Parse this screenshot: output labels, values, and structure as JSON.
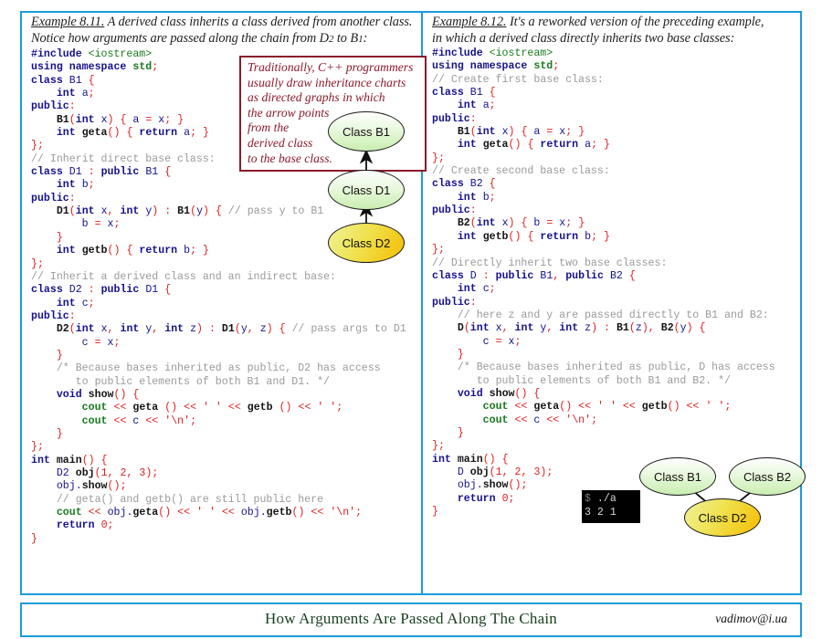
{
  "theme": {
    "frame_color": "#1a9cd8",
    "callout_color": "#8b1a2b",
    "base_node_color": "#c9eeb0",
    "derived_node_color": "#f0e04a",
    "comment_color": "#9a9a9a",
    "keyword_color": "#16128c",
    "punct_color": "#e02020",
    "string_color": "#1a7a1f",
    "footer_title_color": "#19411f"
  },
  "left": {
    "example_label": "Example 8.11.",
    "intro_line1": "A derived class inherits a class derived from another class.",
    "intro_line2_a": "Notice how arguments are passed along the chain from D",
    "intro_line2_sub1": "2",
    "intro_line2_b": " to B",
    "intro_line2_sub2": "1",
    "intro_line2_c": ":",
    "code": "#include <iostream>\nusing namespace std;\nclass B1 {\n    int a;\npublic:\n    B1(int x) { a = x; }\n    int geta() { return a; }\n};\n// Inherit direct base class:\nclass D1 : public B1 {\n    int b;\npublic:\n    D1(int x, int y) : B1(y) { // pass y to B1\n        b = x;\n    }\n    int getb() { return b; }\n};\n// Inherit a derived class and an indirect base:\nclass D2 : public D1 {\n    int c;\npublic:\n    D2(int x, int y, int z) : D1(y, z) { // pass args to D1\n        c = x;\n    }\n    /* Because bases inherited as public, D2 has access\n       to public elements of both B1 and D1. */\n    void show() {\n        cout << geta () << ' ' << getb () << ' ';\n        cout << c << '\\n';\n    }\n};\nint main() {\n    D2 obj(1, 2, 3);\n    obj.show();\n    // geta() and getb() are still public here\n    cout << obj.geta() << ' ' << obj.getb() << '\\n';\n    return 0;\n}",
    "callout": {
      "line1": "Traditionally, C++ programmers",
      "line2": "usually draw inheritance charts",
      "line3": "as directed graphs in which",
      "line4": "the arrow points",
      "line5": "from the",
      "line6": "derived class",
      "line7": "to the base class."
    },
    "diagram": {
      "nodes": [
        {
          "id": "b1",
          "label": "Class B1",
          "kind": "base"
        },
        {
          "id": "d1",
          "label": "Class D1",
          "kind": "base"
        },
        {
          "id": "d2",
          "label": "Class D2",
          "kind": "derived"
        }
      ],
      "edges": [
        {
          "from": "d1",
          "to": "b1"
        },
        {
          "from": "d2",
          "to": "d1"
        }
      ]
    }
  },
  "right": {
    "example_label": "Example 8.12.",
    "intro_line1": "It's a reworked version of the preceding example,",
    "intro_line2": "in which a derived class directly inherits two base classes:",
    "code": "#include <iostream>\nusing namespace std;\n// Create first base class:\nclass B1 {\n    int a;\npublic:\n    B1(int x) { a = x; }\n    int geta() { return a; }\n};\n// Create second base class:\nclass B2 {\n    int b;\npublic:\n    B2(int x) { b = x; }\n    int getb() { return b; }\n};\n// Directly inherit two base classes:\nclass D : public B1, public B2 {\n    int c;\npublic:\n    // here z and y are passed directly to B1 and B2:\n    D(int x, int y, int z) : B1(z), B2(y) {\n        c = x;\n    }\n    /* Because bases inherited as public, D has access\n       to public elements of both B1 and B2. */\n    void show() {\n        cout << geta() << ' ' << getb() << ' ';\n        cout << c << '\\n';\n    }\n};\nint main() {\n    D obj(1, 2, 3);\n    obj.show();\n    return 0;\n}",
    "terminal": {
      "prompt": "$",
      "command": " ./a",
      "output": "3 2 1"
    },
    "diagram": {
      "nodes": [
        {
          "id": "b1",
          "label": "Class B1",
          "kind": "base"
        },
        {
          "id": "b2",
          "label": "Class B2",
          "kind": "base"
        },
        {
          "id": "d2",
          "label": "Class D2",
          "kind": "derived"
        }
      ],
      "edges": [
        {
          "from": "d2",
          "to": "b1"
        },
        {
          "from": "d2",
          "to": "b2"
        }
      ]
    }
  },
  "footer": {
    "title": "How Arguments Are Passed Along The Chain",
    "email": "vadimov@i.ua"
  }
}
